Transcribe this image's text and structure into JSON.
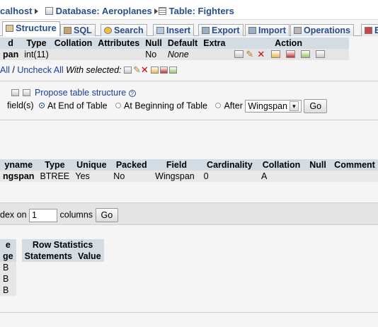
{
  "breadcrumb": {
    "server": "calhost",
    "database": "Database: Aeroplanes",
    "table": "Table: Fighters"
  },
  "tabs": [
    {
      "label": "Structure",
      "active": true
    },
    {
      "label": "SQL"
    },
    {
      "label": "Search"
    },
    {
      "label": "Insert"
    },
    {
      "label": "Export"
    },
    {
      "label": "Import"
    },
    {
      "label": "Operations"
    },
    {
      "label": "E"
    }
  ],
  "fields_table": {
    "headers": [
      "d",
      "Type",
      "Collation",
      "Attributes",
      "Null",
      "Default",
      "Extra",
      "Action"
    ],
    "row": {
      "field": "pan",
      "type": "int(11)",
      "collation": "",
      "attributes": "",
      "null": "No",
      "default": "None",
      "extra": ""
    }
  },
  "check_row": {
    "check_all": "All",
    "separator": " / ",
    "uncheck_all": "Uncheck All",
    "with_selected": "With selected:"
  },
  "propose": {
    "label": "Propose table structure"
  },
  "add_fields": {
    "prefix": "field(s)",
    "end": "At End of Table",
    "beginning": "At Beginning of Table",
    "after": "After",
    "after_value": "Wingspan",
    "go": "Go"
  },
  "indexes_table": {
    "headers": [
      "yname",
      "Type",
      "Unique",
      "Packed",
      "Field",
      "Cardinality",
      "Collation",
      "Null",
      "Comment"
    ],
    "row": {
      "keyname": "ngspan",
      "type": "BTREE",
      "unique": "Yes",
      "packed": "No",
      "field": "Wingspan",
      "cardinality": "0",
      "collation": "A",
      "null": "",
      "comment": ""
    }
  },
  "create_index": {
    "prefix": "dex on",
    "value": "1",
    "suffix": "columns",
    "go": "Go"
  },
  "stats": {
    "headers": [
      "e",
      "Row Statistics"
    ],
    "subheaders": [
      "ge",
      "Statements",
      "Value"
    ],
    "rows": [
      "B",
      "B",
      "B"
    ]
  }
}
